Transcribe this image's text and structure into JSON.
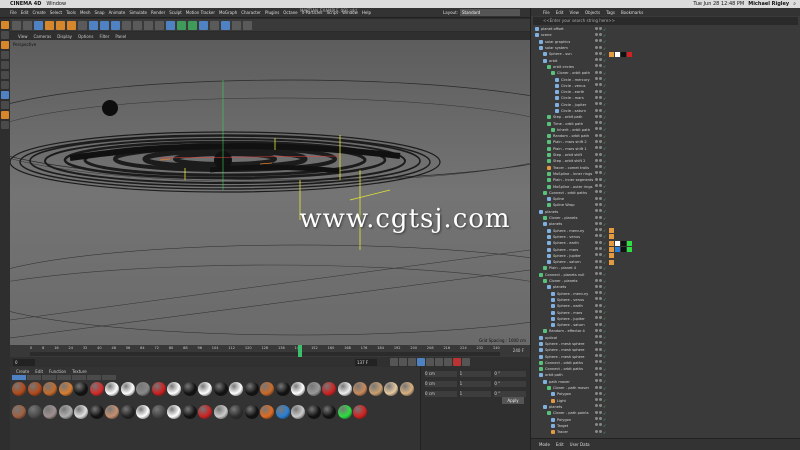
{
  "mac": {
    "app_name": "CINEMA 4D",
    "menu": [
      "Window"
    ],
    "clock": "Tue Jun 28  12:48 PM",
    "user": "Michael Rigley"
  },
  "c4d": {
    "menu": [
      "File",
      "Edit",
      "Create",
      "Select",
      "Tools",
      "Mesh",
      "Snap",
      "Animate",
      "Simulate",
      "Render",
      "Sculpt",
      "Motion Tracker",
      "MoGraph",
      "Character",
      "Plugins",
      "Octane",
      "X-Particles",
      "Script",
      "Window",
      "Help"
    ],
    "file_title": "MARTIAN_EXAMPLE_001.c4d",
    "layout_label": "Layout:",
    "layout_value": "Standard"
  },
  "viewport": {
    "menu": [
      "View",
      "Cameras",
      "Display",
      "Options",
      "Filter",
      "Panel"
    ],
    "label": "Perspective",
    "grid_spacing": "Grid Spacing : 1000 cm"
  },
  "watermark": "www.cgtsj.com",
  "timeline": {
    "ticks": [
      "0",
      "8",
      "16",
      "24",
      "32",
      "40",
      "48",
      "56",
      "64",
      "72",
      "80",
      "88",
      "96",
      "104",
      "112",
      "120",
      "128",
      "136",
      "144",
      "152",
      "160",
      "168",
      "176",
      "184",
      "192",
      "200",
      "208",
      "216",
      "224",
      "232",
      "240"
    ],
    "end_frame": "240 F",
    "current_frame": "137 F",
    "progress": 0.57
  },
  "materials": {
    "menu": [
      "Create",
      "Edit",
      "Function",
      "Texture"
    ],
    "swatches": [
      "#b24a1a",
      "#b24a1a",
      "#c46a2a",
      "#d97d30",
      "#111111",
      "#d42a2a",
      "#ffffff",
      "#ffffff",
      "#888888",
      "#cc1f1f",
      "#ffffff",
      "#111111",
      "#ffffff",
      "#111111",
      "#ffffff",
      "#111111",
      "#cc6a2a",
      "#111111",
      "#ffffff",
      "#999999",
      "#cc2222",
      "#eeeeee",
      "#c98a5a",
      "#c9a070",
      "#e8c9a0",
      "#d8b080",
      "#a06040",
      "#4a4a4a",
      "#a09090",
      "#b0b0b0",
      "#e0e0e0",
      "#111111",
      "#c89070",
      "#222222",
      "#ffffff",
      "#444444",
      "#ffffff",
      "#111111",
      "#cc2222",
      "#cccccc",
      "#2f2f2f",
      "#111111",
      "#e06a20",
      "#2a7fd4",
      "#cccccc",
      "#111111",
      "#111111",
      "#2be040",
      "#d42020"
    ]
  },
  "attributes": {
    "fields": [
      "0 cm",
      "0 cm",
      "0 cm",
      "1",
      "1",
      "1",
      "0 °",
      "0 °",
      "0 °"
    ],
    "apply_label": "Apply"
  },
  "objects": {
    "menu": [
      "File",
      "Edit",
      "View",
      "Objects",
      "Tags",
      "Bookmarks"
    ],
    "search_placeholder": "<<Enter your search string here>>",
    "bottom_tabs": [
      "Mode",
      "Edit",
      "User Data"
    ],
    "tree": [
      {
        "name": "planet offset",
        "depth": 0,
        "icon": "blue"
      },
      {
        "name": "scene",
        "depth": 0,
        "icon": "blue"
      },
      {
        "name": "solar graphics",
        "depth": 1,
        "icon": "blue"
      },
      {
        "name": "solar system",
        "depth": 1,
        "icon": "blue"
      },
      {
        "name": "Sphere - sun",
        "depth": 2,
        "icon": "blue",
        "tags": [
          "#e39a40",
          "#ffffff",
          "#111111",
          "#d42020"
        ]
      },
      {
        "name": "orbit",
        "depth": 2,
        "icon": "blue"
      },
      {
        "name": "orbit circles",
        "depth": 3,
        "icon": "green"
      },
      {
        "name": "Cloner - orbit path",
        "depth": 4,
        "icon": "green"
      },
      {
        "name": "Circle - mercury",
        "depth": 5,
        "icon": "blue"
      },
      {
        "name": "Circle - venus",
        "depth": 5,
        "icon": "blue"
      },
      {
        "name": "Circle - earth",
        "depth": 5,
        "icon": "blue"
      },
      {
        "name": "Circle - mars",
        "depth": 5,
        "icon": "blue"
      },
      {
        "name": "Circle - jupiter",
        "depth": 5,
        "icon": "blue"
      },
      {
        "name": "Circle - saturn",
        "depth": 5,
        "icon": "blue"
      },
      {
        "name": "Step - orbit path",
        "depth": 3,
        "icon": "green"
      },
      {
        "name": "Time - orbit path",
        "depth": 3,
        "icon": "green"
      },
      {
        "name": "Inherit - orbit path",
        "depth": 4,
        "icon": "green"
      },
      {
        "name": "Random - orbit path",
        "depth": 3,
        "icon": "green"
      },
      {
        "name": "Plain - mars shift 2",
        "depth": 3,
        "icon": "green"
      },
      {
        "name": "Plain - mars shift 1",
        "depth": 3,
        "icon": "green"
      },
      {
        "name": "Step - orbit shift",
        "depth": 3,
        "icon": "green"
      },
      {
        "name": "Step - orbit shift 2",
        "depth": 3,
        "icon": "green"
      },
      {
        "name": "Tracer - comet trails",
        "depth": 3,
        "icon": "orange"
      },
      {
        "name": "MoSpline - inner rings",
        "depth": 3,
        "icon": "green"
      },
      {
        "name": "Plain - inner segments",
        "depth": 3,
        "icon": "green"
      },
      {
        "name": "MoSpline - outer rings",
        "depth": 3,
        "icon": "green"
      },
      {
        "name": "Connect - orbit paths",
        "depth": 2,
        "icon": "green"
      },
      {
        "name": "Spline",
        "depth": 3,
        "icon": "blue"
      },
      {
        "name": "Spline Wrap",
        "depth": 3,
        "icon": "green"
      },
      {
        "name": "planets",
        "depth": 1,
        "icon": "blue"
      },
      {
        "name": "Cloner - planets",
        "depth": 2,
        "icon": "green"
      },
      {
        "name": "planets",
        "depth": 2,
        "icon": "blue"
      },
      {
        "name": "Sphere - mercury",
        "depth": 3,
        "icon": "blue",
        "tags": [
          "#e39a40"
        ]
      },
      {
        "name": "Sphere - venus",
        "depth": 3,
        "icon": "blue",
        "tags": [
          "#e39a40"
        ]
      },
      {
        "name": "Sphere - earth",
        "depth": 3,
        "icon": "blue",
        "tags": [
          "#e39a40",
          "#ffffff",
          "#111111",
          "#2be040"
        ]
      },
      {
        "name": "Sphere - mars",
        "depth": 3,
        "icon": "blue",
        "tags": [
          "#e39a40",
          "#2a7fd4",
          "#111111",
          "#2be040"
        ]
      },
      {
        "name": "Sphere - jupiter",
        "depth": 3,
        "icon": "blue",
        "tags": [
          "#e39a40"
        ]
      },
      {
        "name": "Sphere - saturn",
        "depth": 3,
        "icon": "blue",
        "tags": [
          "#e39a40"
        ]
      },
      {
        "name": "Plain - planet 4",
        "depth": 2,
        "icon": "green"
      },
      {
        "name": "Connect - planets null",
        "depth": 1,
        "icon": "green"
      },
      {
        "name": "Cloner - planets",
        "depth": 2,
        "icon": "green"
      },
      {
        "name": "planets",
        "depth": 3,
        "icon": "blue"
      },
      {
        "name": "Sphere - mercury",
        "depth": 4,
        "icon": "blue"
      },
      {
        "name": "Sphere - venus",
        "depth": 4,
        "icon": "blue"
      },
      {
        "name": "Sphere - earth",
        "depth": 4,
        "icon": "blue"
      },
      {
        "name": "Sphere - mars",
        "depth": 4,
        "icon": "blue"
      },
      {
        "name": "Sphere - jupiter",
        "depth": 4,
        "icon": "blue"
      },
      {
        "name": "Sphere - saturn",
        "depth": 4,
        "icon": "blue"
      },
      {
        "name": "Random - effector 4",
        "depth": 2,
        "icon": "green"
      },
      {
        "name": "optical",
        "depth": 1,
        "icon": "blue"
      },
      {
        "name": "Sphere - mesh sphere",
        "depth": 1,
        "icon": "blue"
      },
      {
        "name": "Sphere - mesh sphere",
        "depth": 1,
        "icon": "blue"
      },
      {
        "name": "Sphere - mesh sphere",
        "depth": 1,
        "icon": "blue"
      },
      {
        "name": "Connect - orbit paths",
        "depth": 1,
        "icon": "green"
      },
      {
        "name": "Connect - orbit paths",
        "depth": 1,
        "icon": "green"
      },
      {
        "name": "orbit path",
        "depth": 1,
        "icon": "blue"
      },
      {
        "name": "path mover",
        "depth": 2,
        "icon": "blue"
      },
      {
        "name": "Cloner - path mover",
        "depth": 3,
        "icon": "green"
      },
      {
        "name": "Polygon",
        "depth": 4,
        "icon": "blue"
      },
      {
        "name": "Light",
        "depth": 4,
        "icon": "orange"
      },
      {
        "name": "planets",
        "depth": 2,
        "icon": "blue"
      },
      {
        "name": "Cloner - path points",
        "depth": 3,
        "icon": "green"
      },
      {
        "name": "Polygon",
        "depth": 4,
        "icon": "blue"
      },
      {
        "name": "Target",
        "depth": 4,
        "icon": "blue"
      },
      {
        "name": "Tracer",
        "depth": 4,
        "icon": "orange"
      }
    ]
  }
}
